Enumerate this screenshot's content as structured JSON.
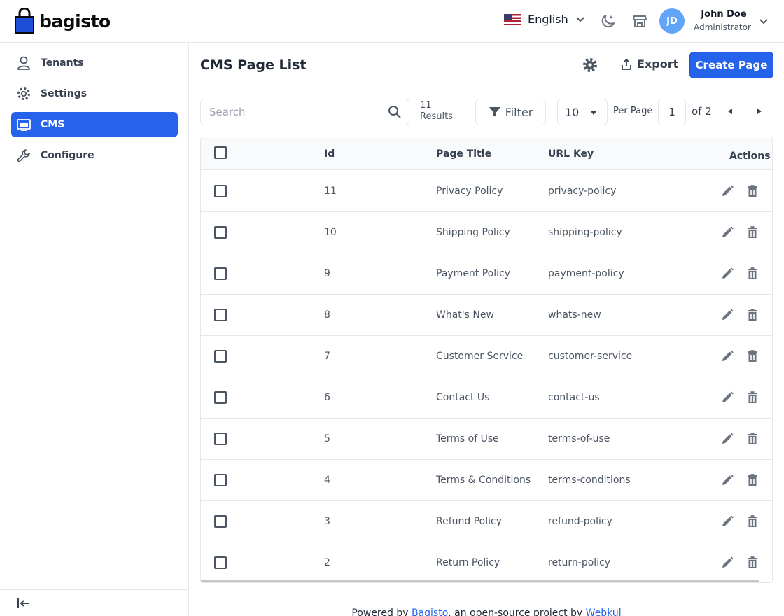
{
  "header": {
    "brand": "bagisto",
    "language": "English",
    "user": {
      "initials": "JD",
      "name": "John Doe",
      "role": "Administrator"
    }
  },
  "sidebar": {
    "items": [
      {
        "label": "Tenants",
        "icon": "user-icon",
        "active": false
      },
      {
        "label": "Settings",
        "icon": "gear-icon",
        "active": false
      },
      {
        "label": "CMS",
        "icon": "monitor-icon",
        "active": true
      },
      {
        "label": "Configure",
        "icon": "wrench-icon",
        "active": false
      }
    ]
  },
  "main": {
    "title": "CMS Page List",
    "export_label": "Export",
    "create_label": "Create Page",
    "search_placeholder": "Search",
    "results_count": "11",
    "results_label": "Results",
    "filter_label": "Filter",
    "per_page_value": "10",
    "per_page_label": "Per Page",
    "current_page": "1",
    "total_pages_label": "of 2"
  },
  "table": {
    "columns": {
      "id": "Id",
      "title": "Page Title",
      "url": "URL Key",
      "actions": "Actions"
    },
    "rows": [
      {
        "id": "11",
        "title": "Privacy Policy",
        "url": "privacy-policy"
      },
      {
        "id": "10",
        "title": "Shipping Policy",
        "url": "shipping-policy"
      },
      {
        "id": "9",
        "title": "Payment Policy",
        "url": "payment-policy"
      },
      {
        "id": "8",
        "title": "What's New",
        "url": "whats-new"
      },
      {
        "id": "7",
        "title": "Customer Service",
        "url": "customer-service"
      },
      {
        "id": "6",
        "title": "Contact Us",
        "url": "contact-us"
      },
      {
        "id": "5",
        "title": "Terms of Use",
        "url": "terms-of-use"
      },
      {
        "id": "4",
        "title": "Terms & Conditions",
        "url": "terms-conditions"
      },
      {
        "id": "3",
        "title": "Refund Policy",
        "url": "refund-policy"
      },
      {
        "id": "2",
        "title": "Return Policy",
        "url": "return-policy"
      }
    ]
  },
  "footer": {
    "prefix": "Powered by ",
    "link1": "Bagisto",
    "middle": ", an open-source project by ",
    "link2": "Webkul"
  },
  "colors": {
    "accent": "#2563eb",
    "icon": "#6b7280"
  }
}
